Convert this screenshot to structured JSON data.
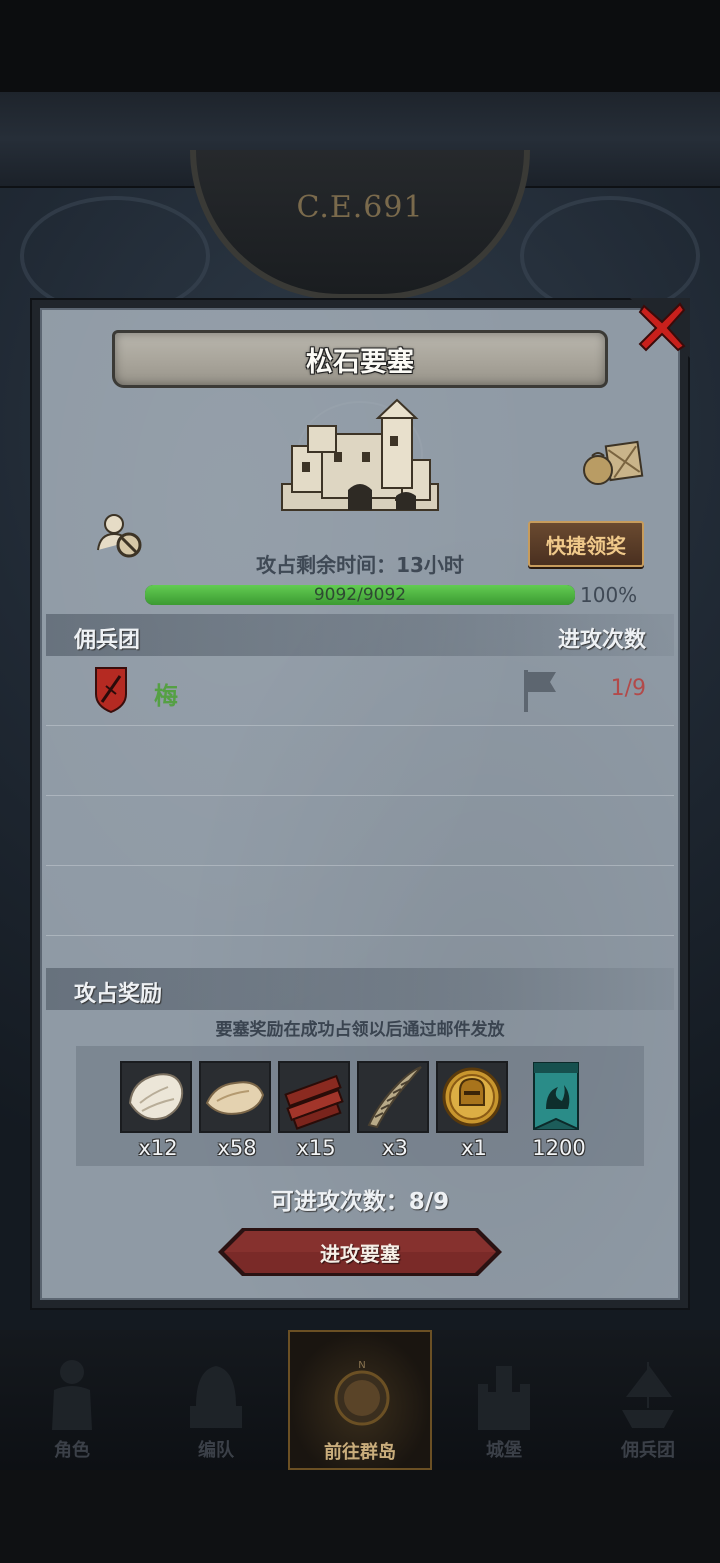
{
  "scene": {
    "era_label": "C.E.691"
  },
  "modal": {
    "title": "松石要塞",
    "quick_claim_label": "快捷领奖",
    "remaining_time": "攻占剩余时间：13小时",
    "hp": {
      "value_text": "9092/9092",
      "percent_text": "100%",
      "fraction": 1.0
    },
    "guild_section": {
      "left_label": "佣兵团",
      "right_label": "进攻次数"
    },
    "guilds": [
      {
        "name": "梅",
        "attacks": "1/9",
        "shield_icon": "red-sword-shield-icon",
        "flag_icon": "gray-flag-icon"
      }
    ],
    "reward_section": {
      "label": "攻占奖励",
      "note": "要塞奖励在成功占领以后通过邮件发放"
    },
    "rewards": [
      {
        "icon": "white-fur-pelt-icon",
        "count": "x12"
      },
      {
        "icon": "tan-fur-pelt-icon",
        "count": "x58"
      },
      {
        "icon": "red-wood-planks-icon",
        "count": "x15"
      },
      {
        "icon": "twisted-horn-icon",
        "count": "x3"
      },
      {
        "icon": "gold-knight-helmet-coin-icon",
        "count": "x1"
      },
      {
        "icon": "teal-banner-icon",
        "count": "1200"
      }
    ],
    "attacks_remaining": "可进攻次数：8/9",
    "attack_button_label": "进攻要塞"
  },
  "bottom_nav": [
    {
      "label": "角色",
      "icon": "knight-armor-icon",
      "active": false
    },
    {
      "label": "编队",
      "icon": "helmet-squad-icon",
      "active": false
    },
    {
      "label": "前往群岛",
      "icon": "compass-globe-icon",
      "active": true
    },
    {
      "label": "城堡",
      "icon": "castle-icon",
      "active": false
    },
    {
      "label": "佣兵团",
      "icon": "ship-icon",
      "active": false
    }
  ],
  "colors": {
    "panel": "#8f9aa5",
    "hp_green": "#4cb43e",
    "guild_name": "#55a044",
    "attack_count": "#b24a4a",
    "attack_button": "#7a2a28",
    "close_red": "#c8201c"
  }
}
